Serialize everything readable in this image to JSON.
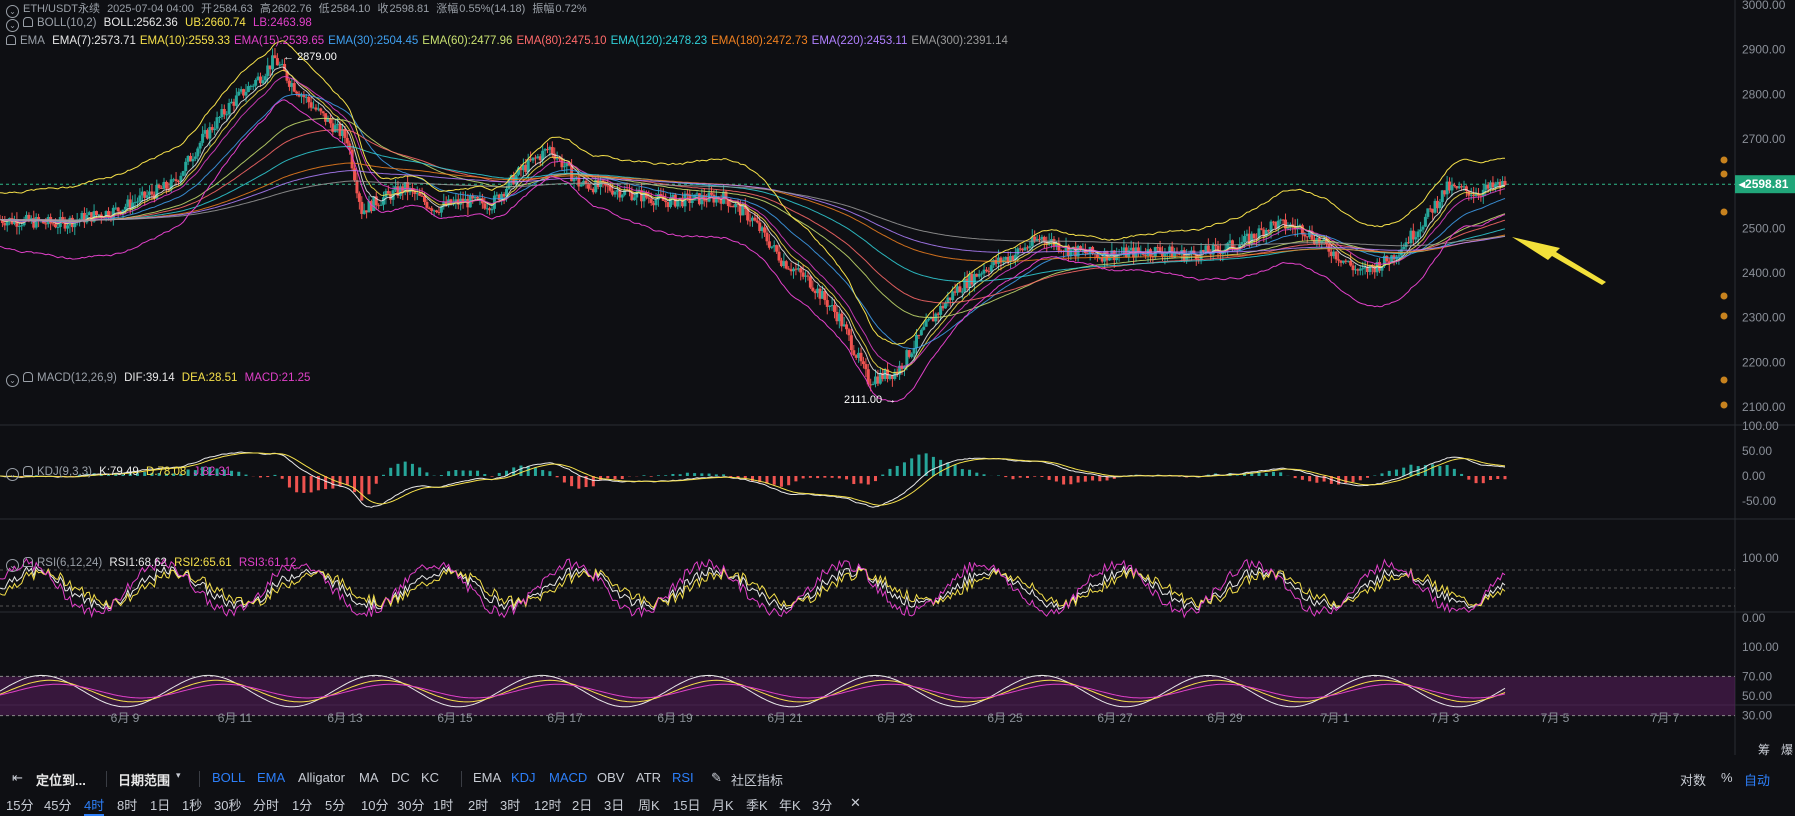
{
  "header": {
    "symbol_line": "ETH/USDT永续",
    "datetime": "2025-07-04 04:00",
    "open_label": "开",
    "open": "2584.63",
    "high_label": "高",
    "high": "2602.76",
    "low_label": "低",
    "low": "2584.10",
    "close_label": "收",
    "close": "2598.81",
    "change_label": "涨幅",
    "change": "0.55%(14.18)",
    "amp_label": "振幅",
    "amp": "0.72%"
  },
  "boll": {
    "name": "BOLL(10,2)",
    "mid": "BOLL:2562.36",
    "ub": "UB:2660.74",
    "lb": "LB:2463.98"
  },
  "ema": {
    "name": "EMA",
    "items": [
      {
        "label": "EMA(7):2573.71",
        "color": "#e8e8e8"
      },
      {
        "label": "EMA(10):2559.33",
        "color": "#f5e04a"
      },
      {
        "label": "EMA(15):2539.65",
        "color": "#e040c8"
      },
      {
        "label": "EMA(30):2504.45",
        "color": "#3fa0f0"
      },
      {
        "label": "EMA(60):2477.96",
        "color": "#c8e070"
      },
      {
        "label": "EMA(80):2475.10",
        "color": "#ff6a6a"
      },
      {
        "label": "EMA(120):2478.23",
        "color": "#30d0d8"
      },
      {
        "label": "EMA(180):2472.73",
        "color": "#f08020"
      },
      {
        "label": "EMA(220):2453.11",
        "color": "#b080ff"
      },
      {
        "label": "EMA(300):2391.14",
        "color": "#9a9a9a"
      }
    ]
  },
  "macd": {
    "name": "MACD(12,26,9)",
    "dif": "DIF:39.14",
    "dea": "DEA:28.51",
    "macd": "MACD:21.25"
  },
  "kdj": {
    "name": "KDJ(9,3,3)",
    "k": "K:79.49",
    "d": "D:78.08",
    "j": "J:82.31"
  },
  "rsi": {
    "name": "RSI(6,12,24)",
    "r1": "RSI1:68.62",
    "r2": "RSI2:65.61",
    "r3": "RSI3:61.12"
  },
  "price_axis": {
    "ticks": [
      "3000.00",
      "2900.00",
      "2800.00",
      "2700.00",
      "2600.00",
      "2500.00",
      "2400.00",
      "2300.00",
      "2200.00",
      "2100.00"
    ],
    "current": "2598.81"
  },
  "macd_axis": [
    "100.00",
    "50.00",
    "0.00",
    "-50.00"
  ],
  "kdj_axis": [
    "100.00",
    "0.00"
  ],
  "rsi_axis": [
    "100.00",
    "70.00",
    "50.00",
    "30.00"
  ],
  "annotations": {
    "high": "2879.00",
    "low": "2111.00"
  },
  "date_axis": [
    "6月 9",
    "6月 11",
    "6月 13",
    "6月 15",
    "6月 17",
    "6月 19",
    "6月 21",
    "6月 23",
    "6月 25",
    "6月 27",
    "6月 29",
    "7月 1",
    "7月 3",
    "7月 5",
    "7月 7"
  ],
  "corner": {
    "a": "筹",
    "b": "爆"
  },
  "toolbar": {
    "locate": "定位到...",
    "date_range": "日期范围",
    "overlays": [
      "BOLL",
      "EMA",
      "Alligator",
      "MA",
      "DC",
      "KC"
    ],
    "indicators": [
      "EMA",
      "KDJ",
      "MACD",
      "OBV",
      "ATR",
      "RSI"
    ],
    "community": "社区指标",
    "right": [
      "对数",
      "%",
      "自动"
    ]
  },
  "timeframes": [
    "15分",
    "45分",
    "4时",
    "8时",
    "1日",
    "1秒",
    "30秒",
    "分时",
    "1分",
    "5分",
    "10分",
    "30分",
    "1时",
    "2时",
    "3时",
    "12时",
    "2日",
    "3日",
    "周K",
    "15日",
    "月K",
    "季K",
    "年K",
    "3分"
  ],
  "active_timeframe": "4时",
  "chart_data": {
    "type": "candlestick",
    "x_range": [
      "6月 8",
      "7月 4"
    ],
    "price_ylim": [
      2100,
      3000
    ],
    "ohlc_close_path": [
      [
        0,
        2520
      ],
      [
        4,
        2510
      ],
      [
        8,
        2540
      ],
      [
        12,
        2600
      ],
      [
        14,
        2700
      ],
      [
        16,
        2780
      ],
      [
        18,
        2840
      ],
      [
        19,
        2879
      ],
      [
        20,
        2830
      ],
      [
        22,
        2760
      ],
      [
        24,
        2700
      ],
      [
        25,
        2540
      ],
      [
        26,
        2560
      ],
      [
        28,
        2590
      ],
      [
        30,
        2545
      ],
      [
        32,
        2560
      ],
      [
        34,
        2555
      ],
      [
        36,
        2630
      ],
      [
        38,
        2680
      ],
      [
        40,
        2600
      ],
      [
        42,
        2590
      ],
      [
        46,
        2560
      ],
      [
        50,
        2570
      ],
      [
        52,
        2520
      ],
      [
        54,
        2430
      ],
      [
        56,
        2380
      ],
      [
        58,
        2300
      ],
      [
        60,
        2160
      ],
      [
        62,
        2180
      ],
      [
        64,
        2280
      ],
      [
        66,
        2360
      ],
      [
        68,
        2410
      ],
      [
        70,
        2440
      ],
      [
        72,
        2480
      ],
      [
        74,
        2450
      ],
      [
        76,
        2440
      ],
      [
        78,
        2445
      ],
      [
        80,
        2450
      ],
      [
        82,
        2440
      ],
      [
        84,
        2450
      ],
      [
        86,
        2470
      ],
      [
        88,
        2510
      ],
      [
        90,
        2500
      ],
      [
        92,
        2450
      ],
      [
        94,
        2400
      ],
      [
        96,
        2430
      ],
      [
        98,
        2500
      ],
      [
        100,
        2590
      ],
      [
        102,
        2580
      ],
      [
        104,
        2598.81
      ]
    ]
  }
}
